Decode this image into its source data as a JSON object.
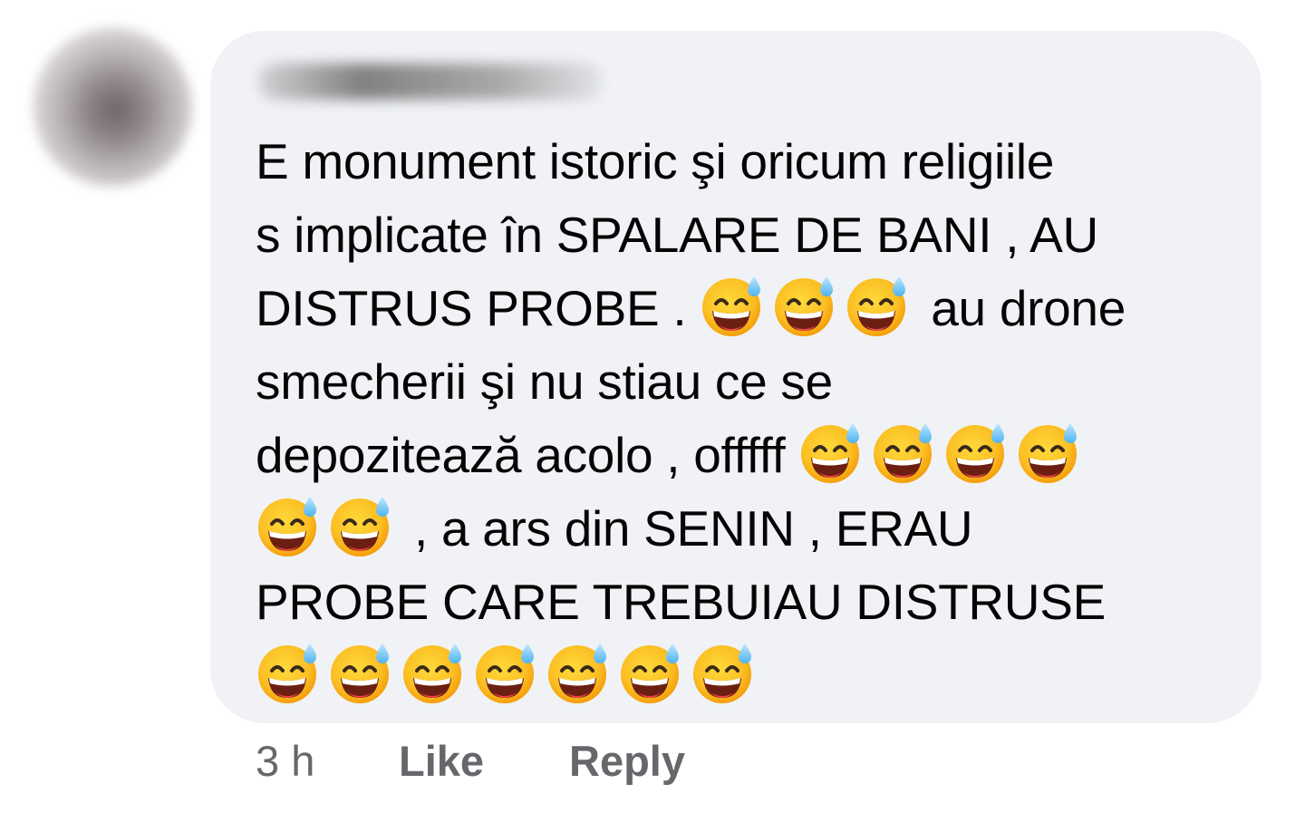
{
  "comment": {
    "author": "",
    "text_segments": [
      "E monument istoric şi oricum religiile",
      "s implicate în SPALARE DE BANI , AU",
      "DISTRUS PROBE . ",
      " au drone",
      "smecherii şi nu stiau ce se",
      "depozitează acolo , offfff ",
      " , a ars din SENIN , ERAU",
      "PROBE CARE TREBUIAU DISTRUSE"
    ],
    "emoji": "grinning-face-with-sweat-icon",
    "emoji_color": "#f7b500"
  },
  "footer": {
    "timestamp": "3 h",
    "like_label": "Like",
    "reply_label": "Reply"
  },
  "colors": {
    "bubble_bg": "#f0f2f5",
    "text": "#050505",
    "meta": "#65676b"
  }
}
